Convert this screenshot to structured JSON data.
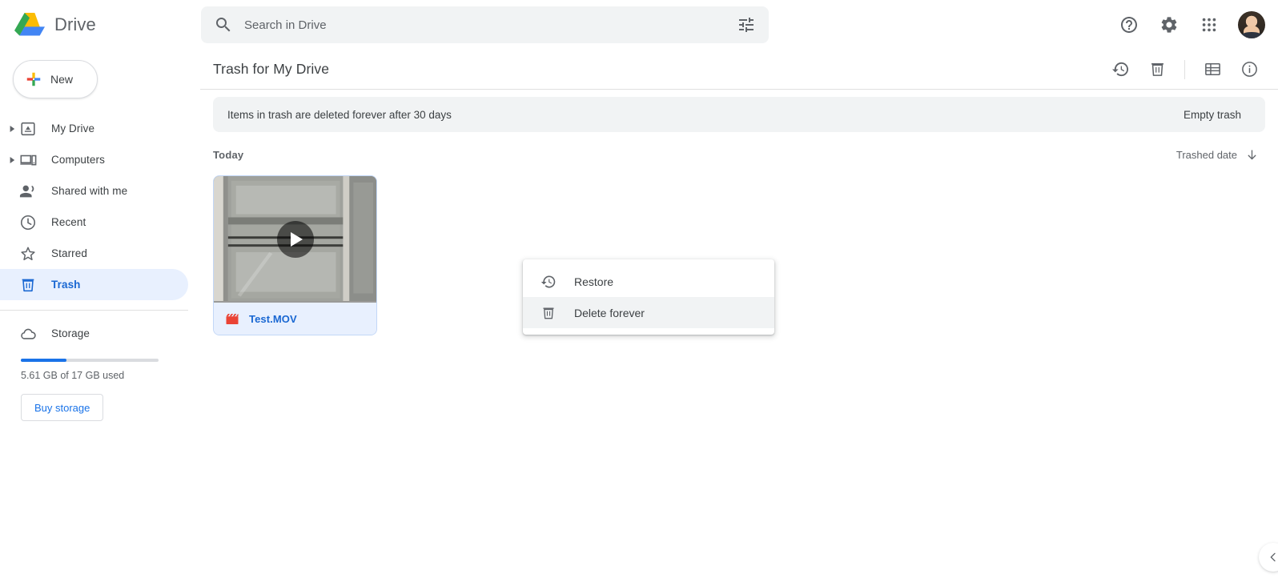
{
  "app": {
    "brand_name": "Drive",
    "logo_icon": "drive-logo-icon"
  },
  "search": {
    "placeholder": "Search in Drive",
    "value": "",
    "search_icon": "search-icon",
    "filter_icon": "tune-filter-icon"
  },
  "topbar_actions": [
    {
      "name": "help-button",
      "icon": "help-circle-icon"
    },
    {
      "name": "settings-button",
      "icon": "gear-icon"
    },
    {
      "name": "google-apps-button",
      "icon": "apps-grid-icon"
    },
    {
      "name": "account-avatar",
      "icon": "avatar-photo"
    }
  ],
  "sidebar": {
    "new_button": {
      "label": "New",
      "icon": "plus-icon"
    },
    "items": [
      {
        "label": "My Drive",
        "icon": "my-drive-icon",
        "expandable": true,
        "active": false
      },
      {
        "label": "Computers",
        "icon": "computers-icon",
        "expandable": true,
        "active": false
      },
      {
        "label": "Shared with me",
        "icon": "shared-people-icon",
        "expandable": false,
        "active": false
      },
      {
        "label": "Recent",
        "icon": "clock-icon",
        "expandable": false,
        "active": false
      },
      {
        "label": "Starred",
        "icon": "star-icon",
        "expandable": false,
        "active": false
      },
      {
        "label": "Trash",
        "icon": "trash-icon",
        "expandable": false,
        "active": true
      }
    ],
    "storage": {
      "label": "Storage",
      "icon": "cloud-icon",
      "used_text": "5.61 GB of 17 GB used",
      "used_percent": 33,
      "buy_label": "Buy storage",
      "bar_color": "#1a73e8"
    }
  },
  "main": {
    "page_title": "Trash for My Drive",
    "header_actions": [
      {
        "name": "restore-from-trash-button",
        "icon": "restore-history-icon"
      },
      {
        "name": "delete-forever-button",
        "icon": "trash-icon"
      },
      {
        "name": "list-view-button",
        "icon": "list-view-icon"
      },
      {
        "name": "details-info-button",
        "icon": "info-circle-icon"
      }
    ],
    "banner": {
      "text": "Items in trash are deleted forever after 30 days",
      "empty_trash_label": "Empty trash"
    },
    "section": {
      "title": "Today",
      "sort_label": "Trashed date",
      "sort_direction_icon": "arrow-down-icon"
    },
    "files": [
      {
        "name": "Test.MOV",
        "type_icon": "video-clapperboard-icon",
        "type_icon_color": "#ea4335",
        "selected": true,
        "has_play_overlay": true
      }
    ]
  },
  "context_menu": {
    "items": [
      {
        "label": "Restore",
        "icon": "restore-history-icon",
        "hovered": false
      },
      {
        "label": "Delete forever",
        "icon": "trash-icon",
        "hovered": true
      }
    ]
  },
  "expand_panel_button": {
    "icon": "chevron-left-icon"
  },
  "colors": {
    "accent_blue": "#1a73e8",
    "selected_blue": "#e8f0fe",
    "text_primary": "#202124",
    "text_secondary": "#5f6368",
    "banner_gray": "#f1f3f4",
    "video_red": "#ea4335"
  }
}
